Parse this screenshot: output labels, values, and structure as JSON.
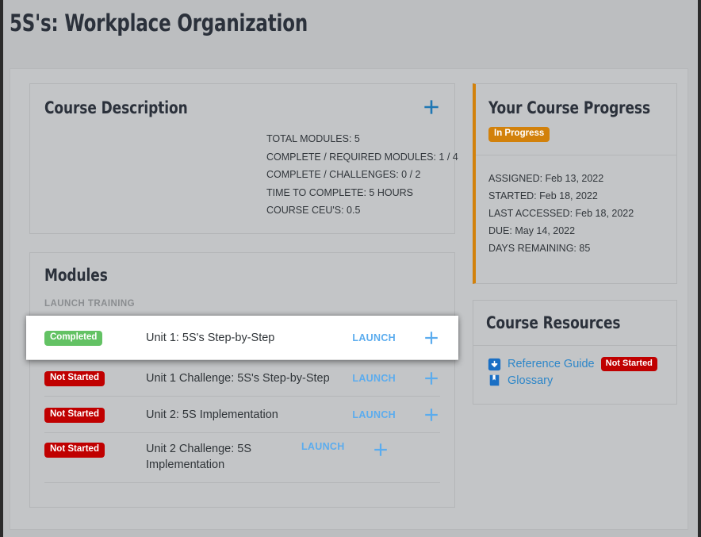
{
  "page": {
    "title": "5S's: Workplace Organization"
  },
  "course_description": {
    "heading": "Course Description",
    "expand_icon": "plus-icon",
    "stats": [
      "TOTAL MODULES: 5",
      "COMPLETE / REQUIRED MODULES: 1 / 4",
      "COMPLETE / CHALLENGES: 0 / 2",
      "TIME TO COMPLETE: 5 HOURS",
      "COURSE CEU'S: 0.5"
    ]
  },
  "modules": {
    "heading": "Modules",
    "subtitle": "LAUNCH TRAINING",
    "launch_label": "LAUNCH",
    "expand_icon": "plus-icon",
    "rows": [
      {
        "status": "Completed",
        "status_kind": "completed",
        "title": "Unit 1: 5S's Step-by-Step",
        "launch": "LAUNCH",
        "highlighted": true
      },
      {
        "status": "Not Started",
        "status_kind": "notstarted",
        "title": "Unit 1 Challenge: 5S's Step-by-Step",
        "launch": "LAUNCH",
        "highlighted": false
      },
      {
        "status": "Not Started",
        "status_kind": "notstarted",
        "title": "Unit 2: 5S Implementation",
        "launch": "LAUNCH",
        "highlighted": false
      },
      {
        "status": "Not Started",
        "status_kind": "notstarted",
        "title": "Unit 2 Challenge: 5S Implementation",
        "launch": "LAUNCH",
        "highlighted": false
      }
    ]
  },
  "progress": {
    "heading": "Your Course Progress",
    "status_badge": "In Progress",
    "lines": [
      "ASSIGNED: Feb 13, 2022",
      "STARTED: Feb 18, 2022",
      "LAST ACCESSED: Feb 18, 2022",
      "DUE: May 14, 2022",
      "DAYS REMAINING: 85"
    ]
  },
  "resources": {
    "heading": "Course Resources",
    "items": [
      {
        "icon": "download-icon",
        "label": "Reference Guide",
        "badge": "Not Started"
      },
      {
        "icon": "book-bookmark-icon",
        "label": "Glossary",
        "badge": null
      }
    ]
  },
  "colors": {
    "accent_blue": "#1f77b4",
    "link_blue": "#5bacee",
    "resource_blue": "#2d86c8",
    "completed_green": "#63c264",
    "not_started_red": "#c00000",
    "in_progress_orange": "#d2810b",
    "page_background": "#bcbec0",
    "panel_background": "#c3c5c7",
    "heading_text": "#2b313b"
  }
}
